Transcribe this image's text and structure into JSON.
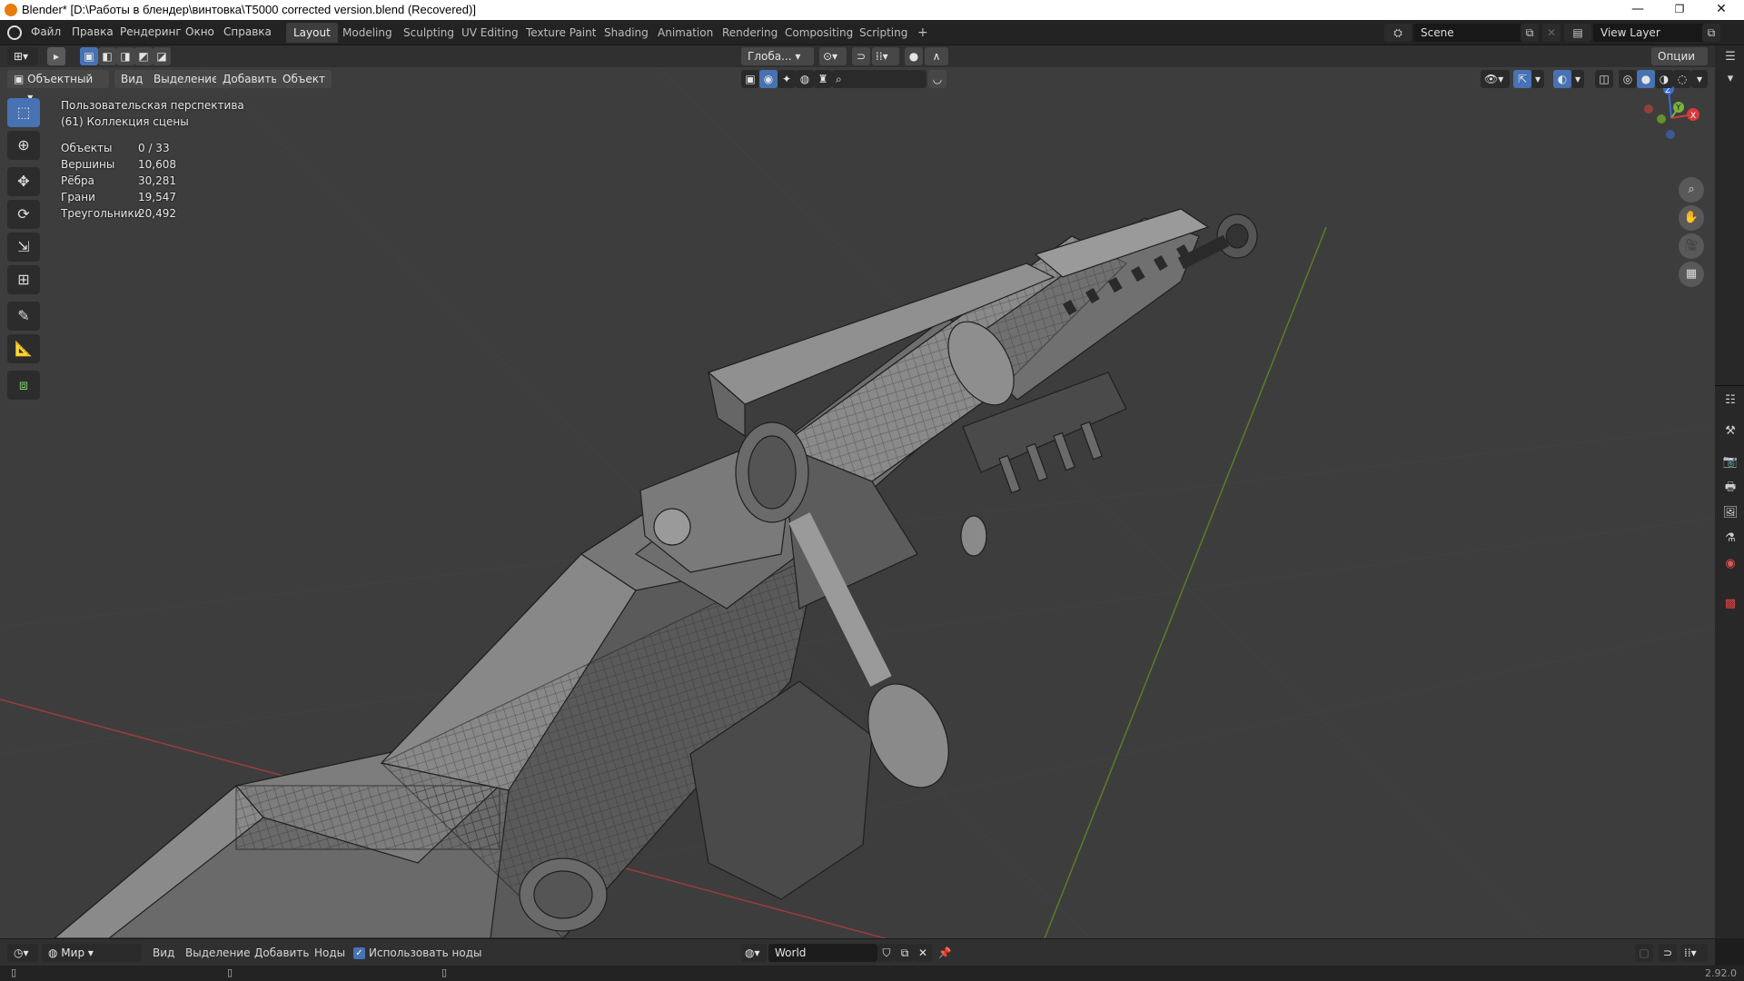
{
  "window": {
    "title": "Blender* [D:\\Работы в блендер\\винтовка\\T5000 corrected version.blend (Recovered)]",
    "minimize": "—",
    "restore": "❐",
    "close": "✕"
  },
  "menu": [
    "Файл",
    "Правка",
    "Рендеринг",
    "Окно",
    "Справка"
  ],
  "workspaces": [
    "Layout",
    "Modeling",
    "Sculpting",
    "UV Editing",
    "Texture Paint",
    "Shading",
    "Animation",
    "Rendering",
    "Compositing",
    "Scripting"
  ],
  "active_workspace": "Layout",
  "add_workspace": "+",
  "scene": {
    "value": "Scene",
    "view_layer": "View Layer"
  },
  "viewport_header": {
    "transform_orientation": "Глоба...",
    "options": "Опции",
    "mode": "Объектный ...",
    "menus": [
      "Вид",
      "Выделение",
      "Добавить",
      "Объект"
    ]
  },
  "overlay": {
    "view_name": "Пользовательская перспектива",
    "collection": "(61) Коллекция сцены",
    "stats": [
      {
        "label": "Объекты",
        "value": "0 / 33"
      },
      {
        "label": "Вершины",
        "value": "10,608"
      },
      {
        "label": "Рёбра",
        "value": "30,281"
      },
      {
        "label": "Грани",
        "value": "19,547"
      },
      {
        "label": "Треугольники",
        "value": "20,492"
      }
    ]
  },
  "gizmo": {
    "z": "Z",
    "y": "Y",
    "x": "X"
  },
  "bottom_header": {
    "world_type": "Мир",
    "menus": [
      "Вид",
      "Выделение",
      "Добавить",
      "Ноды"
    ],
    "use_nodes_label": "Использовать ноды",
    "world_name": "World"
  },
  "status": {
    "version": "2.92.0"
  },
  "colors": {
    "accent": "#4772b3",
    "viewport": "#3d3d3d",
    "x_axis": "#b03a3a",
    "y_axis": "#6a9a2a"
  }
}
